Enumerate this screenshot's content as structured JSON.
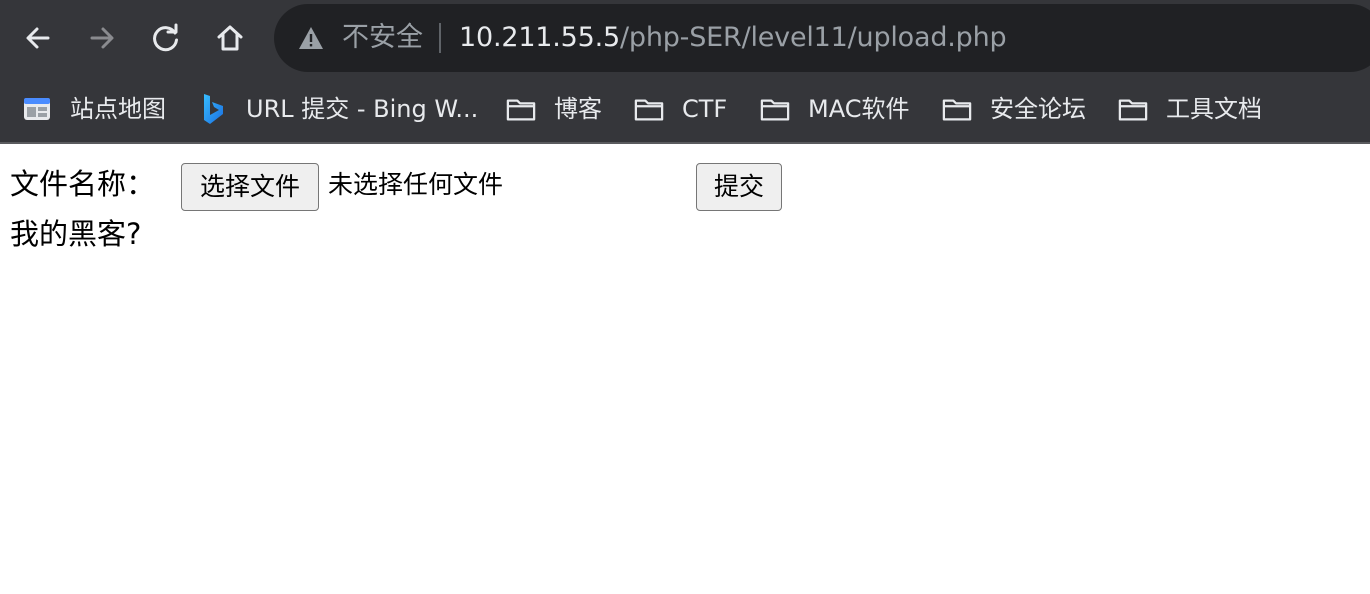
{
  "browser": {
    "toolbar": {
      "back_icon": "arrow-left-icon",
      "forward_icon": "arrow-right-icon",
      "reload_icon": "reload-icon",
      "home_icon": "home-icon"
    },
    "address_bar": {
      "security_icon": "warning-triangle-icon",
      "security_label": "不安全",
      "url_host": "10.211.55.5",
      "url_path": "/php-SER/level11/upload.php"
    },
    "bookmarks": [
      {
        "label": "站点地图",
        "icon": "sitemap-icon"
      },
      {
        "label": "URL 提交 - Bing W...",
        "icon": "bing-icon"
      },
      {
        "label": "博客",
        "icon": "folder-icon"
      },
      {
        "label": "CTF",
        "icon": "folder-icon"
      },
      {
        "label": "MAC软件",
        "icon": "folder-icon"
      },
      {
        "label": "安全论坛",
        "icon": "folder-icon"
      },
      {
        "label": "工具文档",
        "icon": "folder-icon"
      }
    ]
  },
  "form": {
    "file_label": "文件名称：",
    "choose_button": "选择文件",
    "file_status": "未选择任何文件",
    "submit_button": "提交"
  },
  "result_text": "我的黑客?"
}
